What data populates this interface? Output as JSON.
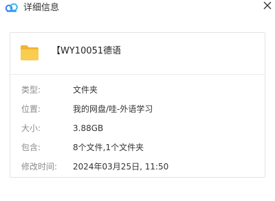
{
  "window": {
    "title": "详细信息",
    "logo_icon": "baidu-netdisk-cloud-icon",
    "close_icon": "close-icon"
  },
  "file": {
    "icon": "folder-icon",
    "name": "【WY10051德语"
  },
  "properties": [
    {
      "label": "类型:",
      "value": "文件夹"
    },
    {
      "label": "位置:",
      "value": "我的网盘/哇-外语学习"
    },
    {
      "label": "大小:",
      "value": "3.88GB"
    },
    {
      "label": "包含:",
      "value": "8个文件,1个文件夹"
    },
    {
      "label": "修改时间:",
      "value": "2024年03月25日, 11:50"
    }
  ],
  "colors": {
    "folder": "#f6c342",
    "logo_blue": "#2f7bf6",
    "label": "#8a8a8a",
    "value": "#333333"
  }
}
